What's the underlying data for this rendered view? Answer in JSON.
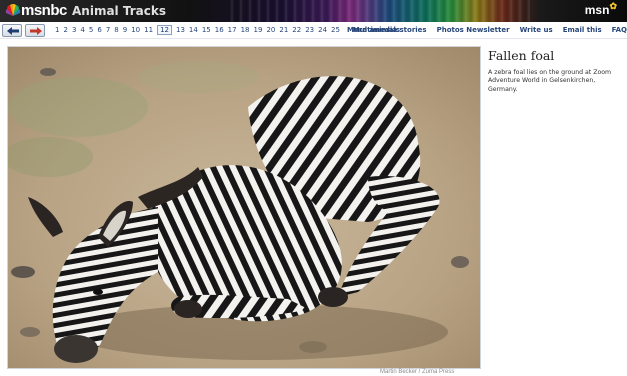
{
  "header": {
    "brand": "msnbc",
    "section": "Animal Tracks",
    "msn_logo": "msn"
  },
  "nav": {
    "pages": [
      "1",
      "2",
      "3",
      "4",
      "5",
      "6",
      "7",
      "8",
      "9",
      "10",
      "11",
      "12",
      "13",
      "14",
      "15",
      "16",
      "17",
      "18",
      "19",
      "20",
      "21",
      "22",
      "23",
      "24",
      "25"
    ],
    "current_page": "12",
    "more_label": "More animals",
    "links": [
      "Multimedia stories",
      "Photos Newsletter",
      "Write us",
      "Email this",
      "FAQ"
    ]
  },
  "photo": {
    "subject": "zebra-foal",
    "credit": "Martin Becker / Zuma Press"
  },
  "caption": {
    "title": "Fallen foal",
    "text": "A zebra foal lies on the ground at Zoom Adventure World in Gelsenkirchen, Germany."
  },
  "colors": {
    "link": "#27467a",
    "next_arrow": "#c0392b",
    "prev_arrow": "#1d3d70"
  }
}
